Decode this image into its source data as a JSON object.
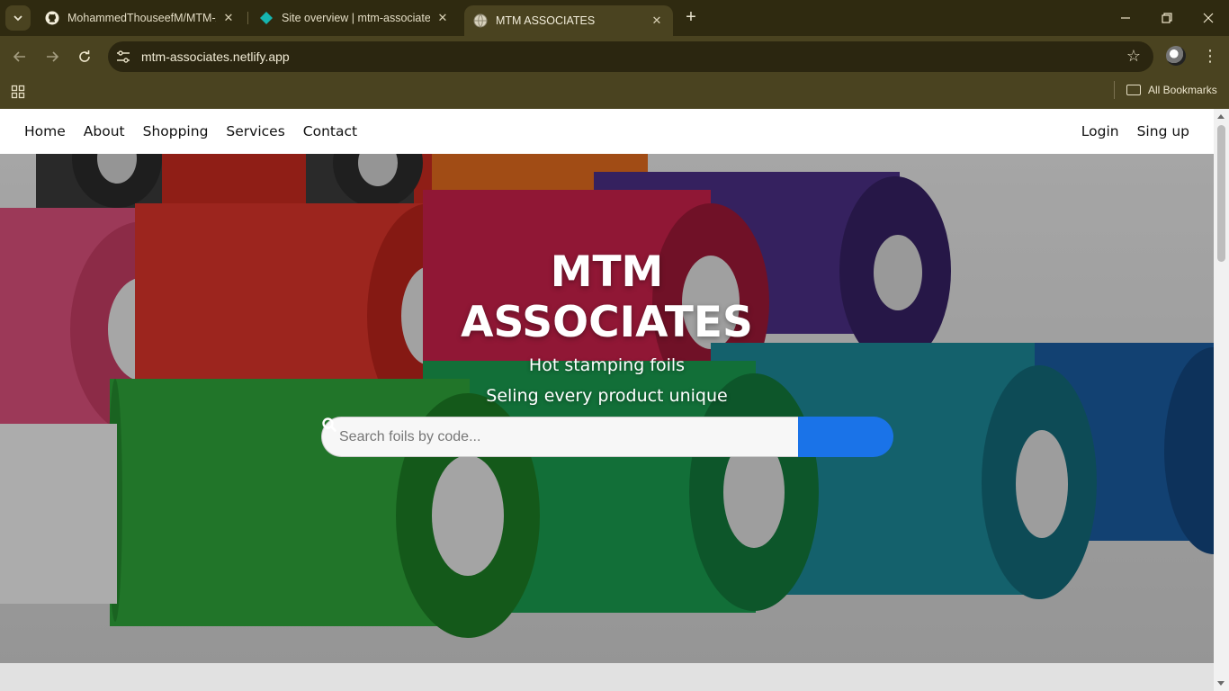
{
  "browser": {
    "tabs": [
      {
        "title": "MohammedThouseefM/MTM-A",
        "icon": "github-icon"
      },
      {
        "title": "Site overview | mtm-associates",
        "icon": "netlify-icon"
      },
      {
        "title": "MTM ASSOCIATES",
        "icon": "globe-icon",
        "active": true
      }
    ],
    "url": "mtm-associates.netlify.app",
    "bookmarks_label": "All Bookmarks"
  },
  "site": {
    "nav": {
      "links": [
        "Home",
        "About",
        "Shopping",
        "Services",
        "Contact"
      ],
      "auth": [
        "Login",
        "Sing up"
      ]
    },
    "hero": {
      "title_line1": "MTM",
      "title_line2": "ASSOCIATES",
      "subtitle1": "Hot stamping foils",
      "subtitle2": "Seling every product unique",
      "search_placeholder": "Search foils by code..."
    }
  },
  "colors": {
    "browser_frame": "#4a4320",
    "search_button": "#1a73e8"
  }
}
